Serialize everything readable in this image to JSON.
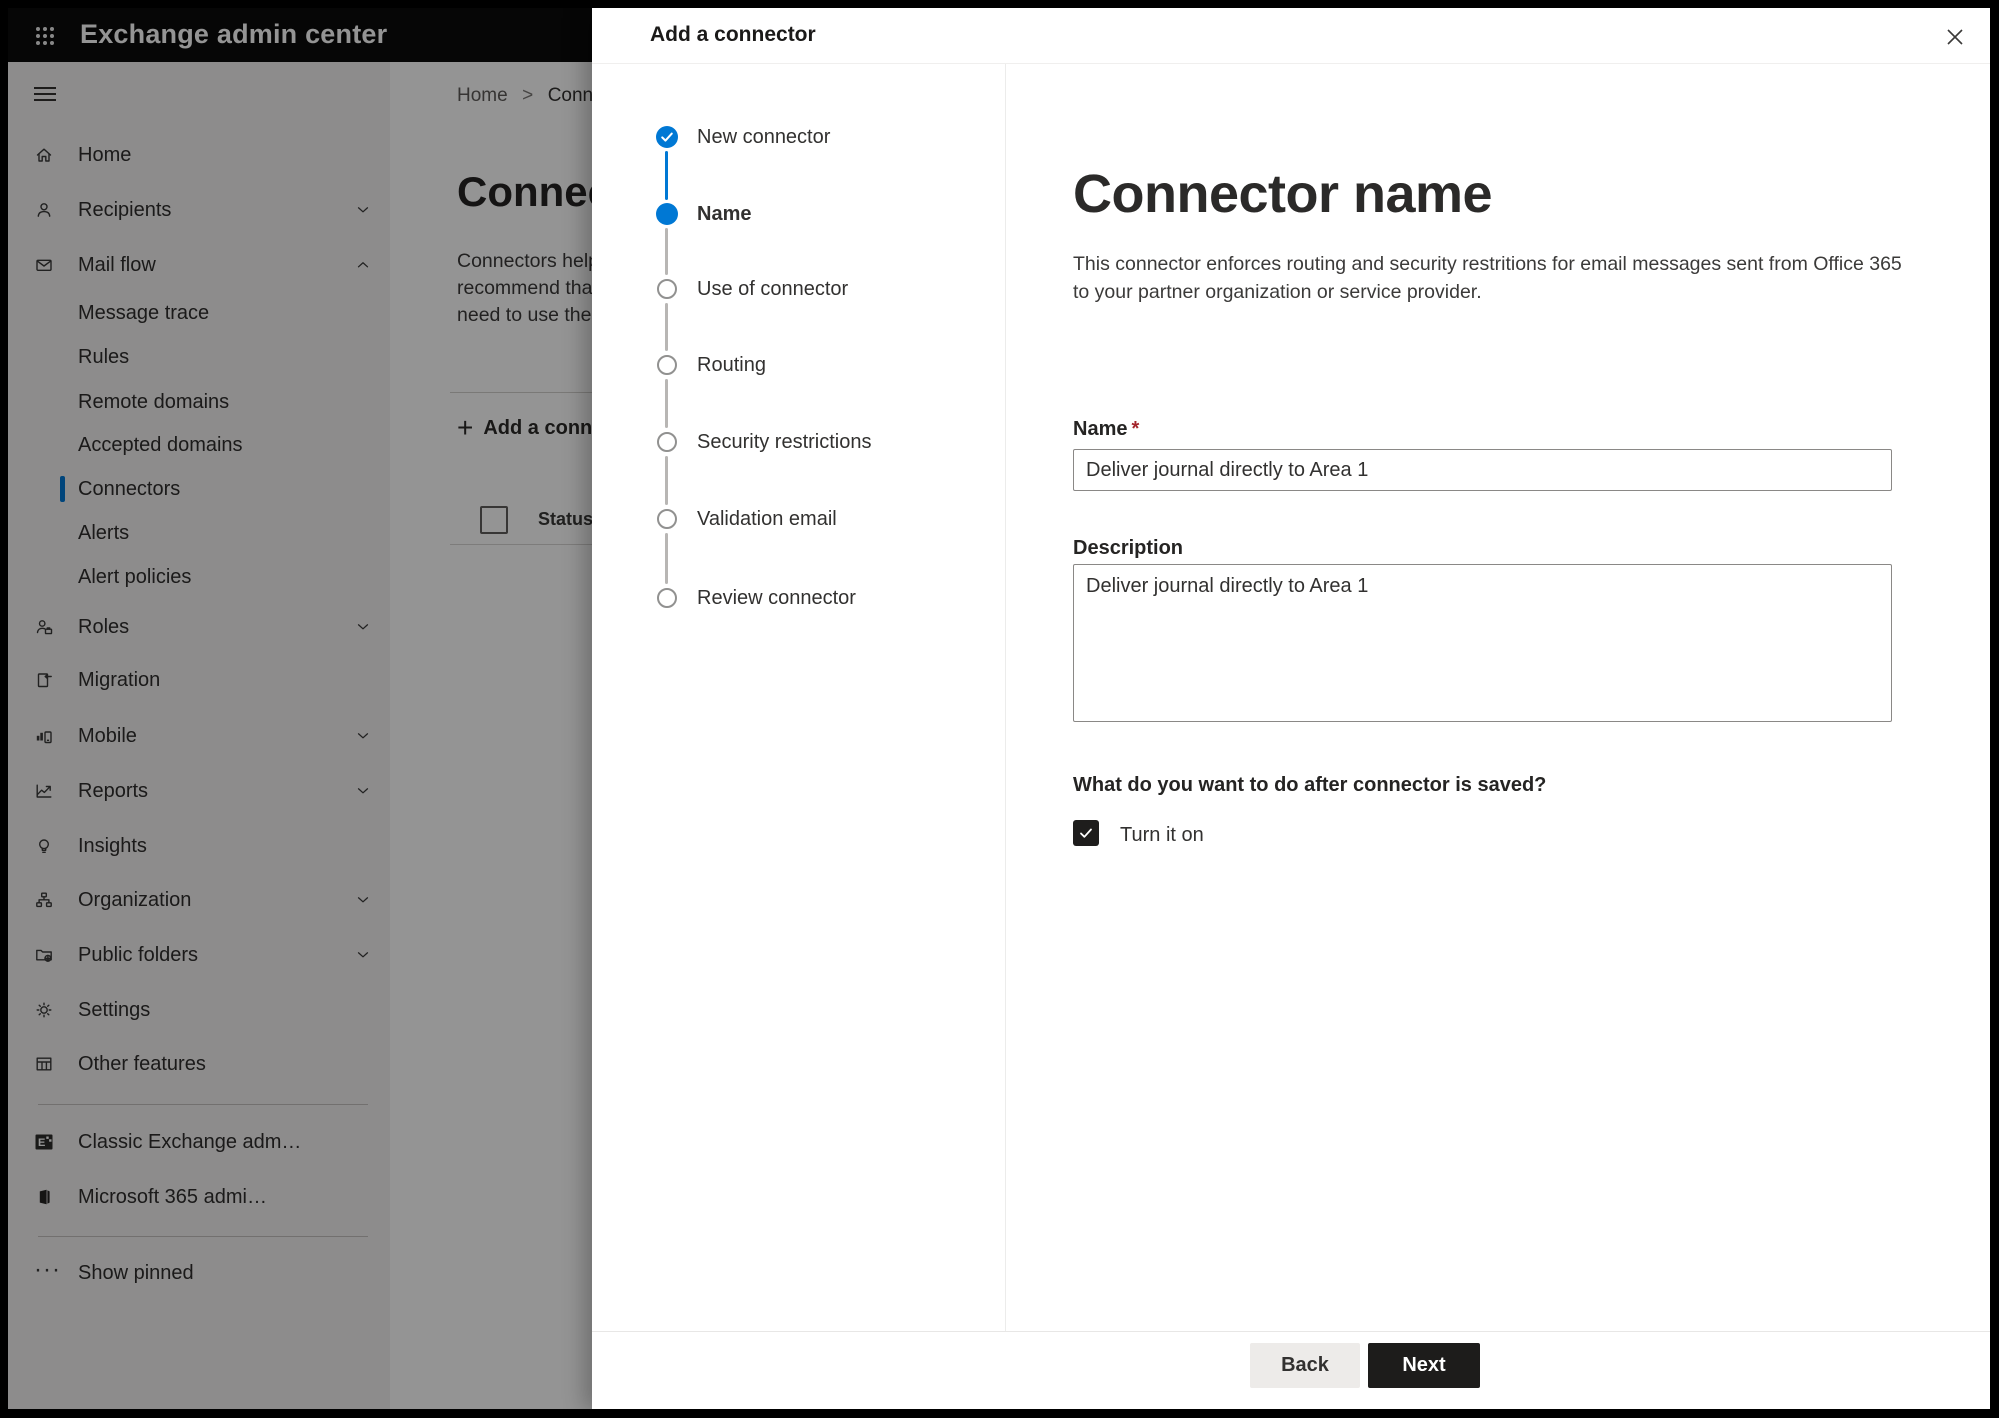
{
  "colors": {
    "accent": "#0078d4",
    "topbar_bg": "#0b0b0b",
    "next_btn_bg": "#1d1c1b",
    "back_btn_bg": "#edebe9",
    "required_red": "#a4262c"
  },
  "topbar": {
    "app_title": "Exchange admin center"
  },
  "sidebar": {
    "items": [
      {
        "label": "Home",
        "icon": "home"
      },
      {
        "label": "Recipients",
        "icon": "person",
        "chevron": "down"
      },
      {
        "label": "Mail flow",
        "icon": "mail",
        "chevron": "up"
      },
      {
        "label": "Roles",
        "icon": "roles",
        "chevron": "down"
      },
      {
        "label": "Migration",
        "icon": "migration"
      },
      {
        "label": "Mobile",
        "icon": "mobile",
        "chevron": "down"
      },
      {
        "label": "Reports",
        "icon": "reports",
        "chevron": "down"
      },
      {
        "label": "Insights",
        "icon": "insights"
      },
      {
        "label": "Organization",
        "icon": "org-chart",
        "chevron": "down"
      },
      {
        "label": "Public folders",
        "icon": "folder-globe",
        "chevron": "down"
      },
      {
        "label": "Settings",
        "icon": "gear"
      },
      {
        "label": "Other features",
        "icon": "table-grid"
      }
    ],
    "mailflow_subitems": [
      {
        "label": "Message trace"
      },
      {
        "label": "Rules"
      },
      {
        "label": "Remote domains"
      },
      {
        "label": "Accepted domains"
      },
      {
        "label": "Connectors",
        "selected": true
      },
      {
        "label": "Alerts"
      },
      {
        "label": "Alert policies"
      }
    ],
    "footer_items": [
      {
        "label": "Classic Exchange adm…",
        "icon": "exchange-logo"
      },
      {
        "label": "Microsoft 365 admi…",
        "icon": "office-logo"
      },
      {
        "label": "Show pinned",
        "icon": "ellipsis"
      }
    ]
  },
  "page": {
    "breadcrumb": {
      "home": "Home",
      "separator": ">",
      "current": "Conne"
    },
    "heading_fragment": "Connec",
    "para_lines": [
      "Connectors help",
      "recommend that",
      "need to use ther"
    ],
    "add_button_fragment": "Add a conn",
    "add_button_plus": "+",
    "table": {
      "status_header": "Status"
    }
  },
  "dialog": {
    "title": "Add a connector",
    "close_glyph": "✕",
    "steps": [
      {
        "label": "New connector",
        "state": "done"
      },
      {
        "label": "Name",
        "state": "current"
      },
      {
        "label": "Use of connector",
        "state": "todo"
      },
      {
        "label": "Routing",
        "state": "todo"
      },
      {
        "label": "Security restrictions",
        "state": "todo"
      },
      {
        "label": "Validation email",
        "state": "todo"
      },
      {
        "label": "Review connector",
        "state": "todo"
      }
    ],
    "content": {
      "title": "Connector name",
      "desc_lines": [
        "This connector enforces routing and security restritions for email messages sent from Office 365",
        "to your partner organization or service provider."
      ],
      "name_label": "Name",
      "name_required_mark": "*",
      "name_value": "Deliver journal directly to Area 1",
      "description_label": "Description",
      "description_value": "Deliver journal directly to Area 1",
      "after_save_heading": "What do you want to do after connector is saved?",
      "turn_on_label": "Turn it on",
      "turn_on_checked": true
    },
    "footer": {
      "back_label": "Back",
      "next_label": "Next"
    }
  }
}
